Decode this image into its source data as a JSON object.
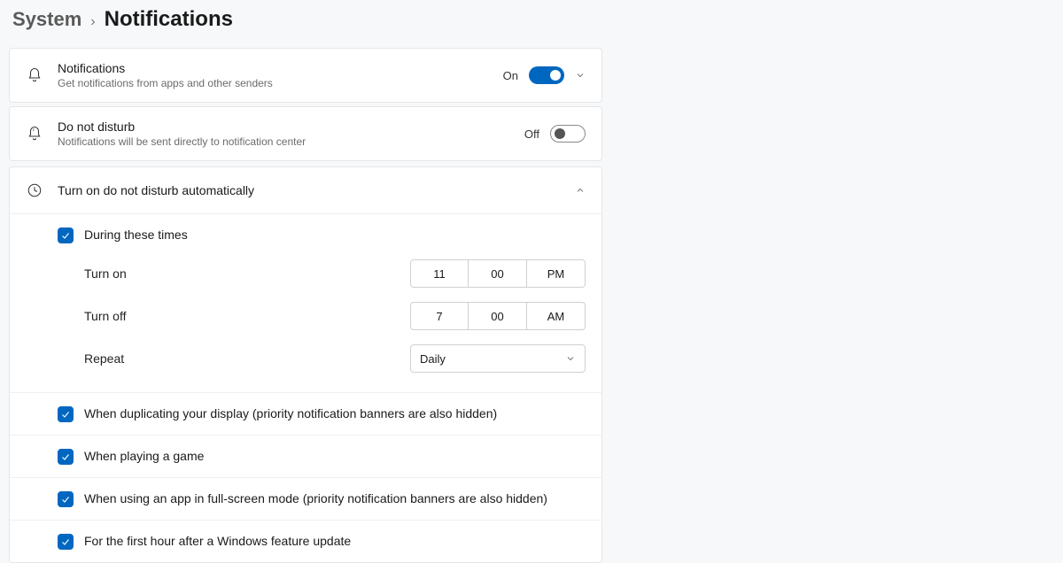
{
  "breadcrumb": {
    "parent": "System",
    "current": "Notifications"
  },
  "notifications": {
    "title": "Notifications",
    "subtitle": "Get notifications from apps and other senders",
    "state_label": "On"
  },
  "dnd": {
    "title": "Do not disturb",
    "subtitle": "Notifications will be sent directly to notification center",
    "state_label": "Off"
  },
  "auto": {
    "header": "Turn on do not disturb automatically",
    "during_times_label": "During these times",
    "turn_on_label": "Turn on",
    "turn_on": {
      "hour": "11",
      "minute": "00",
      "ampm": "PM"
    },
    "turn_off_label": "Turn off",
    "turn_off": {
      "hour": "7",
      "minute": "00",
      "ampm": "AM"
    },
    "repeat_label": "Repeat",
    "repeat_value": "Daily",
    "checks": {
      "duplicating": "When duplicating your display (priority notification banners are also hidden)",
      "gaming": "When playing a game",
      "fullscreen": "When using an app in full-screen mode (priority notification banners are also hidden)",
      "feature_update": "For the first hour after a Windows feature update"
    }
  }
}
